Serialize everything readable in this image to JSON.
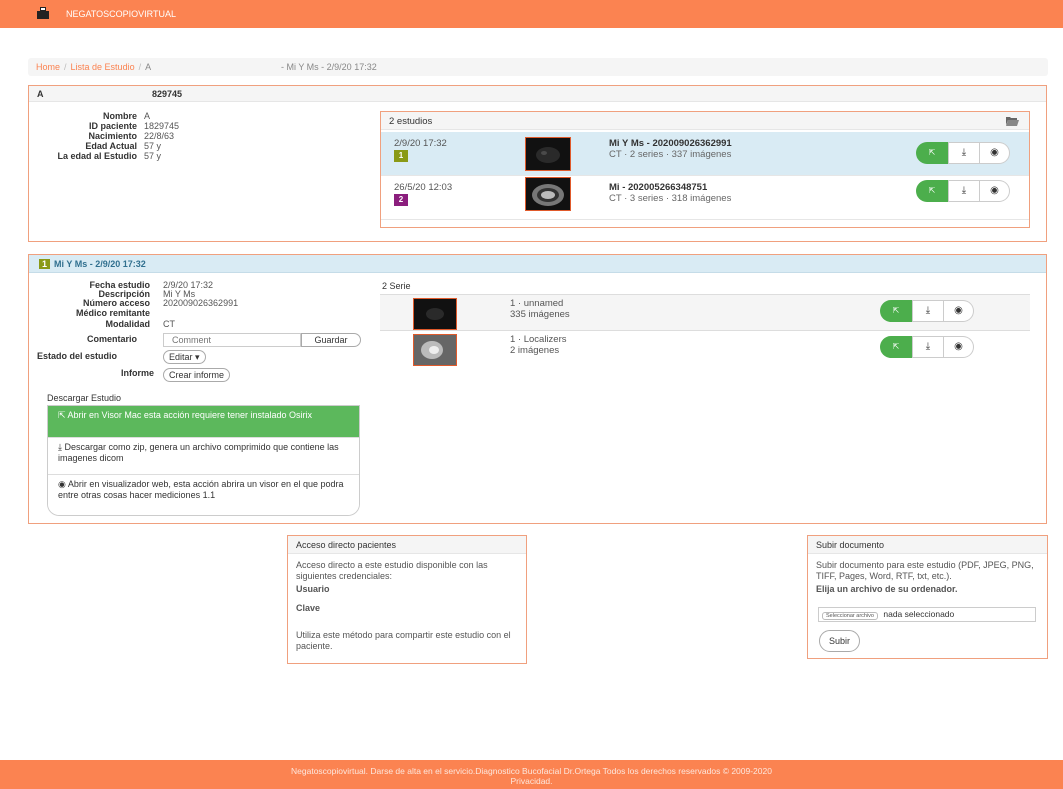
{
  "app": {
    "brand": "NEGATOSCOPIOVIRTUAL"
  },
  "breadcrumb": {
    "home": "Home",
    "list": "Lista de Estudio",
    "current": "A",
    "detail": "- Mi Y Ms - 2/9/20 17:32"
  },
  "patient": {
    "header_name": "A",
    "header_id": "829745",
    "fields": [
      {
        "label": "Nombre",
        "value": "A"
      },
      {
        "label": "ID paciente",
        "value": "1829745"
      },
      {
        "label": "Nacimiento",
        "value": "22/8/63"
      },
      {
        "label": "Edad Actual",
        "value": "57 y"
      },
      {
        "label": "La edad al Estudio",
        "value": "57 y"
      }
    ]
  },
  "studies": {
    "title": "2 estudios",
    "folder_icon": "folder-open-icon",
    "items": [
      {
        "date": "2/9/20 17:32",
        "badge": "1",
        "badge_color": "#8a9a16",
        "title": "Mi Y Ms - 202009026362991",
        "sub": "CT · 2 series · 337 imágenes"
      },
      {
        "date": "26/5/20 12:03",
        "badge": "2",
        "badge_color": "#8b1e7d",
        "title": "Mi - 202005266348751",
        "sub": "CT · 3 series · 318 imágenes"
      }
    ]
  },
  "study_detail": {
    "badge": "1",
    "title": "Mi Y Ms - 2/9/20 17:32",
    "fields": [
      {
        "label": "Fecha estudio",
        "value": "2/9/20 17:32"
      },
      {
        "label": "Descripción",
        "value": "Mi Y Ms"
      },
      {
        "label": "Número acceso",
        "value": "202009026362991"
      },
      {
        "label": "Médico remitante",
        "value": ""
      },
      {
        "label": "Modalidad",
        "value": "CT"
      }
    ],
    "comment_label": "Comentario",
    "comment_placeholder": "Comment",
    "save_label": "Guardar",
    "estado_label": "Estado del estudio",
    "edit_label": "Editar ▾",
    "informe_label": "Informe",
    "create_report_label": "Crear informe",
    "download_heading": "Descargar Estudio",
    "download_options": [
      {
        "icon": "osirix-icon",
        "text": "Abrir en Visor Mac esta acción requiere tener instalado Osirix"
      },
      {
        "icon": "download-icon",
        "text": "Descargar como zip, genera un archivo comprimido que contiene las imagenes dicom"
      },
      {
        "icon": "eye-icon",
        "text": "Abrir en visualizador web, esta acción abrira un visor en el que podra entre otras cosas hacer mediciones 1.1"
      }
    ]
  },
  "series": {
    "title": "2 Serie",
    "items": [
      {
        "name": "1 · unnamed",
        "count": "335 imágenes"
      },
      {
        "name": "1 · Localizers",
        "count": "2 imágenes"
      }
    ]
  },
  "access": {
    "title": "Acceso directo pacientes",
    "intro": "Acceso directo a este estudio disponible con las siguientes credenciales:",
    "user_label": "Usuario",
    "pass_label": "Clave",
    "note": "Utiliza este método para compartir este estudio con el paciente."
  },
  "upload": {
    "title": "Subir documento",
    "intro": "Subir documento para este estudio (PDF, JPEG, PNG, TIFF, Pages, Word, RTF, txt, etc.).",
    "choose_label": "Elija un archivo de su ordenador.",
    "file_button": "Seleccionar archivo",
    "file_status": "nada seleccionado",
    "submit_label": "Subir"
  },
  "footer": {
    "line1": "Negatoscopiovirtual. Darse de alta en el servicio.Diagnostico Bucofacial Dr.Ortega Todos los derechos reservados © 2009-2020",
    "line2": "Privacidad."
  }
}
